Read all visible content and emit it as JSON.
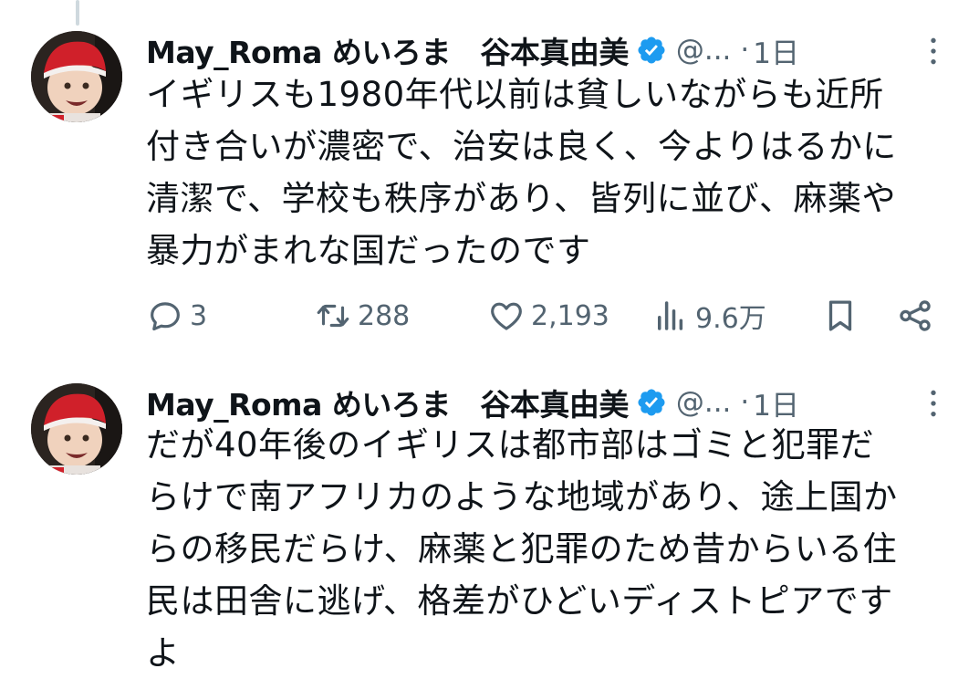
{
  "tweets": [
    {
      "display_name": "May_Roma めいろま　谷本真由美",
      "handle": "@...",
      "time": "1日",
      "text": "イギリスも1980年代以前は貧しいながらも近所\n付き合いが濃密で、治安は良く、今よりはるかに\n清潔で、学校も秩序があり、皆列に並び、麻薬や\n暴力がまれな国だったのです",
      "stats": {
        "replies": "3",
        "retweets": "288",
        "likes": "2,193",
        "views": "9.6万"
      }
    },
    {
      "display_name": "May_Roma めいろま　谷本真由美",
      "handle": "@...",
      "time": "1日",
      "text": "だが40年後のイギリスは都市部はゴミと犯罪だ\nらけで南アフリカのような地域があり、途上国か\nらの移民だらけ、麻薬と犯罪のため昔からいる住\n民は田舎に逃げ、格差がひどいディストピアです\nよ"
    }
  ],
  "separator": "·",
  "icons": {
    "verified": "verified-badge-icon",
    "more": "more-dots-icon",
    "reply": "reply-icon",
    "retweet": "retweet-icon",
    "like": "heart-icon",
    "views": "views-bar-chart-icon",
    "bookmark": "bookmark-icon",
    "share": "share-icon"
  },
  "colors": {
    "text": "#0f1419",
    "muted": "#536471",
    "verified": "#1d9bf0",
    "thread_line": "#cfd9de"
  }
}
